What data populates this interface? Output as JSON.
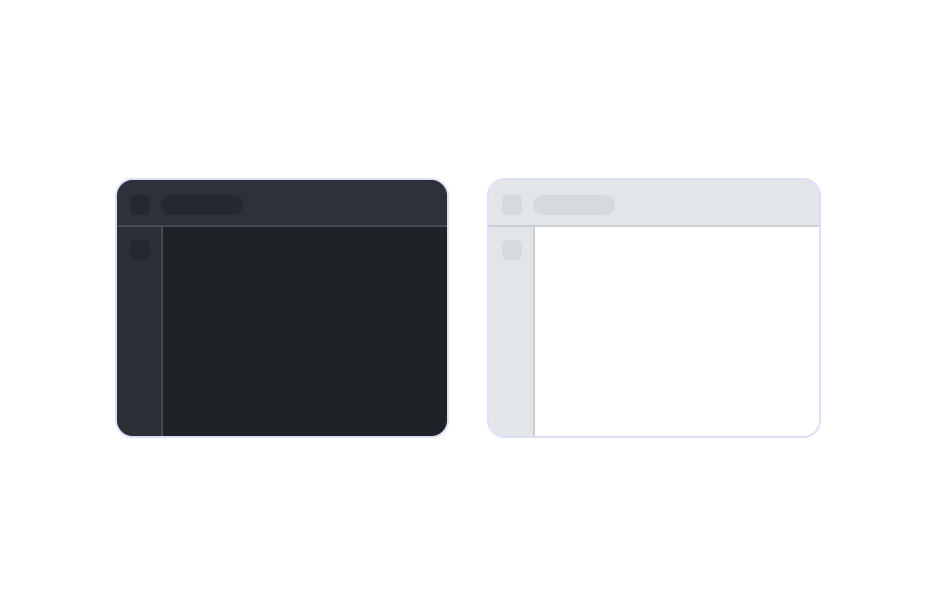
{
  "themes": [
    {
      "id": "dark",
      "colors": {
        "titlebar": "#2d323a",
        "sidebar": "#2b2f36",
        "content": "#1f2226",
        "placeholder": "#242830",
        "divider": "#454b54"
      }
    },
    {
      "id": "light",
      "colors": {
        "titlebar": "#e3e6e8",
        "sidebar": "#e3e6e8",
        "content": "#ffffff",
        "placeholder": "#d6dadd",
        "divider": "#c9ced4"
      }
    }
  ],
  "card_border_color": "#ddddf7"
}
